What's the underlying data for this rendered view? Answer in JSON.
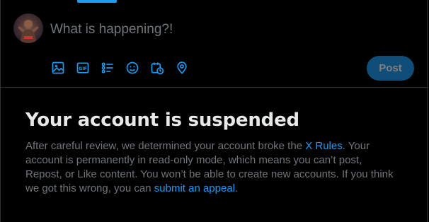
{
  "composer": {
    "placeholder": "What is happening?!",
    "post_label": "Post",
    "avatar": "user-avatar",
    "tools": [
      {
        "icon": "image-icon"
      },
      {
        "icon": "gif-icon",
        "text": "GIF"
      },
      {
        "icon": "poll-icon"
      },
      {
        "icon": "emoji-icon"
      },
      {
        "icon": "schedule-icon"
      },
      {
        "icon": "location-icon"
      }
    ]
  },
  "notice": {
    "title": "Your account is suspended",
    "body_part1": "After careful review, we determined your account broke the ",
    "rules_link": "X Rules",
    "body_part2": ". Your account is permanently in read-only mode, which means you can’t post, Repost, or Like content. You won’t be able to create new accounts. If you think we got this wrong, you can ",
    "appeal_link": "submit an appeal",
    "body_part3": "."
  },
  "colors": {
    "background": "#000000",
    "accent": "#1d9bf0",
    "post_button_disabled": "#0f4e78",
    "muted_text": "#71767b",
    "primary_text": "#e7e9ea",
    "border": "#2f3336"
  }
}
